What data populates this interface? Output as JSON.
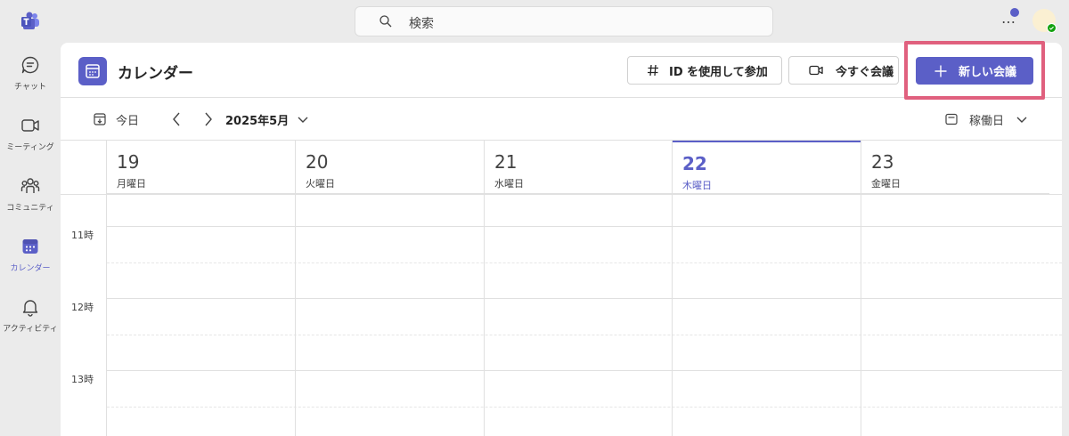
{
  "search": {
    "placeholder": "検索"
  },
  "rail": [
    {
      "label": "チャット",
      "icon": "chat-icon",
      "active": false
    },
    {
      "label": "ミーティング",
      "icon": "video-icon",
      "active": false
    },
    {
      "label": "コミュニティ",
      "icon": "people-community-icon",
      "active": false
    },
    {
      "label": "カレンダー",
      "icon": "calendar-icon",
      "active": true
    },
    {
      "label": "アクティビティ",
      "icon": "bell-icon",
      "active": false
    }
  ],
  "header": {
    "title": "カレンダー",
    "join_label": "ID を使用して参加",
    "meet_now_label": "今すぐ会議",
    "new_meeting_label": "新しい会議"
  },
  "toolbar": {
    "today_label": "今日",
    "month_label": "2025年5月",
    "view_label": "稼働日"
  },
  "days": [
    {
      "num": "19",
      "name": "月曜日",
      "today": false
    },
    {
      "num": "20",
      "name": "火曜日",
      "today": false
    },
    {
      "num": "21",
      "name": "水曜日",
      "today": false
    },
    {
      "num": "22",
      "name": "木曜日",
      "today": true
    },
    {
      "num": "23",
      "name": "金曜日",
      "today": false
    }
  ],
  "times": [
    "11時",
    "12時",
    "13時"
  ],
  "colors": {
    "accent": "#5b5fc7",
    "highlight": "#e0607e",
    "presence": "#13a10e"
  }
}
